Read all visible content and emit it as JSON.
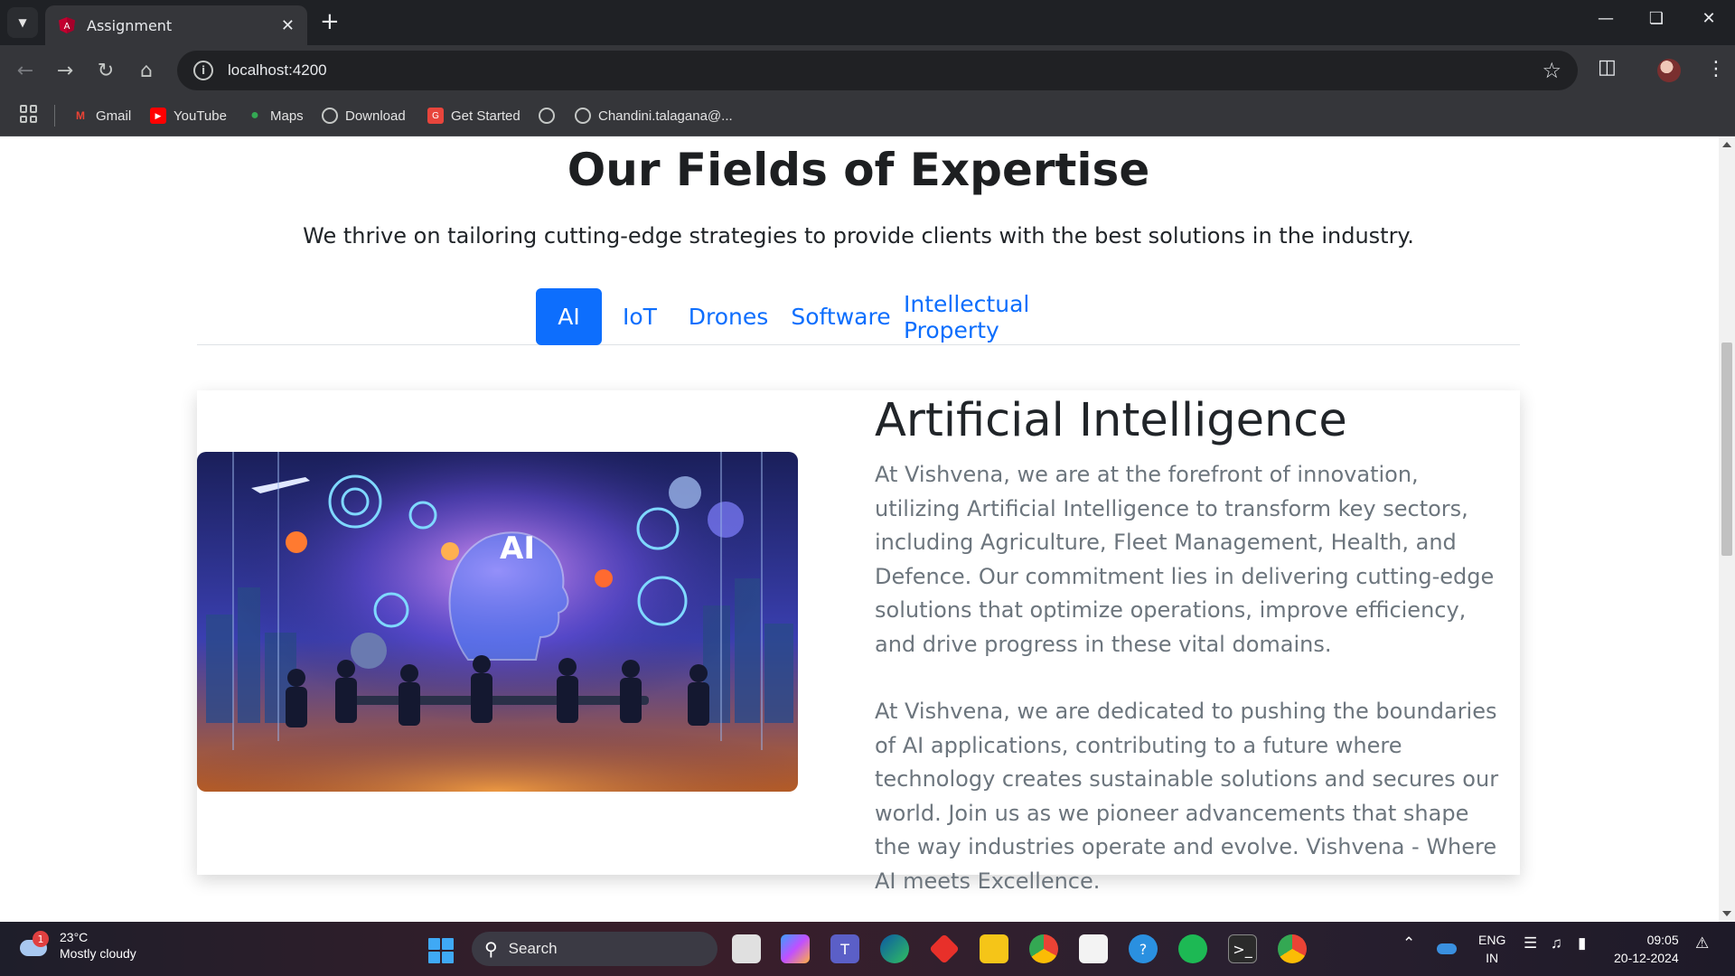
{
  "browser": {
    "tab_title": "Assignment",
    "url": "localhost:4200",
    "bookmarks": [
      {
        "label": "Gmail",
        "icon": "gmail-icon"
      },
      {
        "label": "YouTube",
        "icon": "youtube-icon"
      },
      {
        "label": "Maps",
        "icon": "maps-icon"
      },
      {
        "label": "Download",
        "icon": "globe-icon"
      },
      {
        "label": "Get Started",
        "icon": "get-started-icon"
      },
      {
        "label": "",
        "icon": "globe-icon"
      },
      {
        "label": "Chandini.talagana@...",
        "icon": "globe-icon"
      }
    ]
  },
  "section": {
    "title": "Our Fields of Expertise",
    "subtitle": "We thrive on tailoring cutting-edge strategies to provide clients with the best solutions in the industry."
  },
  "tabs": [
    {
      "label": "AI",
      "active": true
    },
    {
      "label": "IoT",
      "active": false
    },
    {
      "label": "Drones",
      "active": false
    },
    {
      "label": "Software",
      "active": false
    },
    {
      "label": "Intellectual Property",
      "active": false
    }
  ],
  "card": {
    "heading": "Artificial Intelligence",
    "paragraph1": "At Vishvena, we are at the forefront of innovation, utilizing Artificial Intelligence to transform key sectors, including Agriculture, Fleet Management, Health, and Defence. Our commitment lies in delivering cutting-edge solutions that optimize operations, improve efficiency, and drive progress in these vital domains.",
    "paragraph2": "At Vishvena, we are dedicated to pushing the boundaries of AI applications, contributing to a future where technology creates sustainable solutions and secures our world. Join us as we pioneer advancements that shape the way industries operate and evolve. Vishvena - Where AI meets Excellence.",
    "image_text": "AI"
  },
  "taskbar": {
    "weather_badge": "1",
    "temperature": "23°C",
    "condition": "Mostly cloudy",
    "search_label": "Search",
    "lang_line1": "ENG",
    "lang_line2": "IN",
    "time": "09:05",
    "date": "20-12-2024"
  },
  "colors": {
    "accent": "#0d6efd",
    "heading": "#212529",
    "body_text": "#6c757d"
  }
}
